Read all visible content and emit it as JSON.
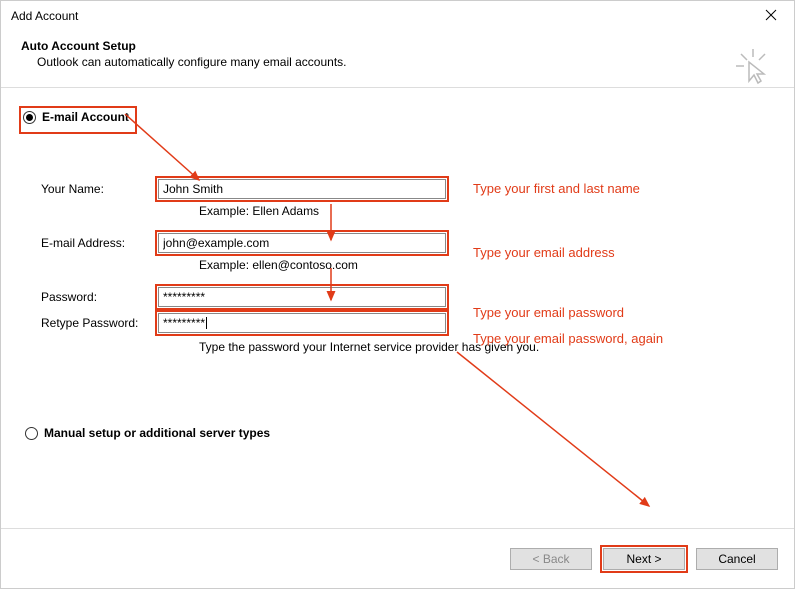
{
  "window": {
    "title": "Add Account"
  },
  "header": {
    "title": "Auto Account Setup",
    "subtitle": "Outlook can automatically configure many email accounts."
  },
  "radio": {
    "email_account": "E-mail Account",
    "manual": "Manual setup or additional server types"
  },
  "fields": {
    "name_label": "Your Name:",
    "name_value": "John Smith",
    "name_example": "Example: Ellen Adams",
    "email_label": "E-mail Address:",
    "email_value": "john@example.com",
    "email_example": "Example: ellen@contoso.com",
    "password_label": "Password:",
    "password_value": "*********",
    "retype_label": "Retype Password:",
    "retype_value": "*********",
    "password_hint": "Type the password your Internet service provider has given you."
  },
  "callouts": {
    "name": "Type your first and last name",
    "email": "Type your email address",
    "password": "Type your email password",
    "retype": "Type your email password, again"
  },
  "buttons": {
    "back": "< Back",
    "next": "Next >",
    "cancel": "Cancel"
  },
  "colors": {
    "highlight": "#e13b18"
  }
}
